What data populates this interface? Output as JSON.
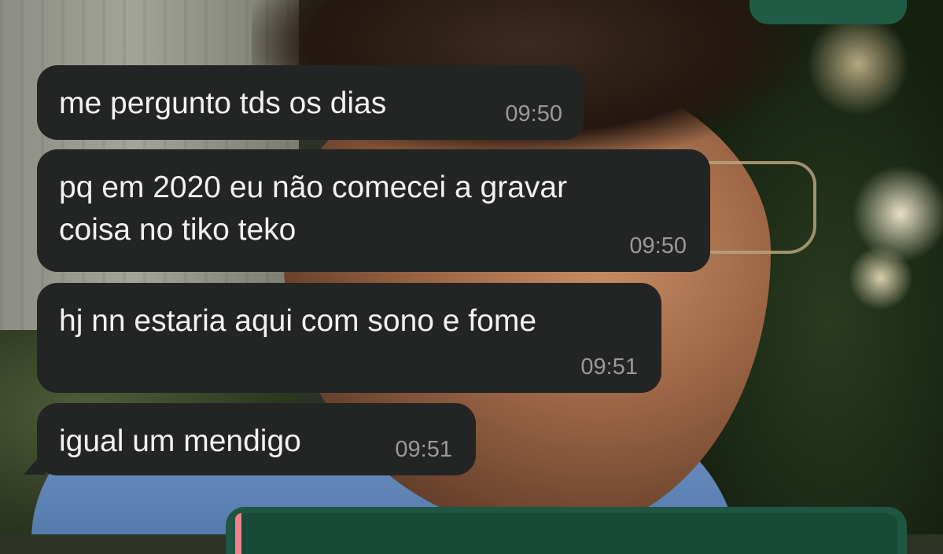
{
  "chat": {
    "messages": [
      {
        "text": "me pergunto tds os dias",
        "time": "09:50",
        "direction": "incoming"
      },
      {
        "text_line1": "pq em 2020 eu não comecei a gravar",
        "text_line2": "coisa no tiko teko",
        "time": "09:50",
        "direction": "incoming"
      },
      {
        "text": "hj nn estaria aqui com sono e fome",
        "time": "09:51",
        "direction": "incoming"
      },
      {
        "text": "igual um mendigo",
        "time": "09:51",
        "direction": "incoming"
      }
    ],
    "outgoing_top": {
      "status_icon": "double-check-icon"
    },
    "outgoing_reply": {
      "quote_color": "#f0808c"
    }
  },
  "colors": {
    "incoming_bubble": "#232424",
    "outgoing_bubble": "#1e5641",
    "timestamp": "#9a9a9a"
  }
}
